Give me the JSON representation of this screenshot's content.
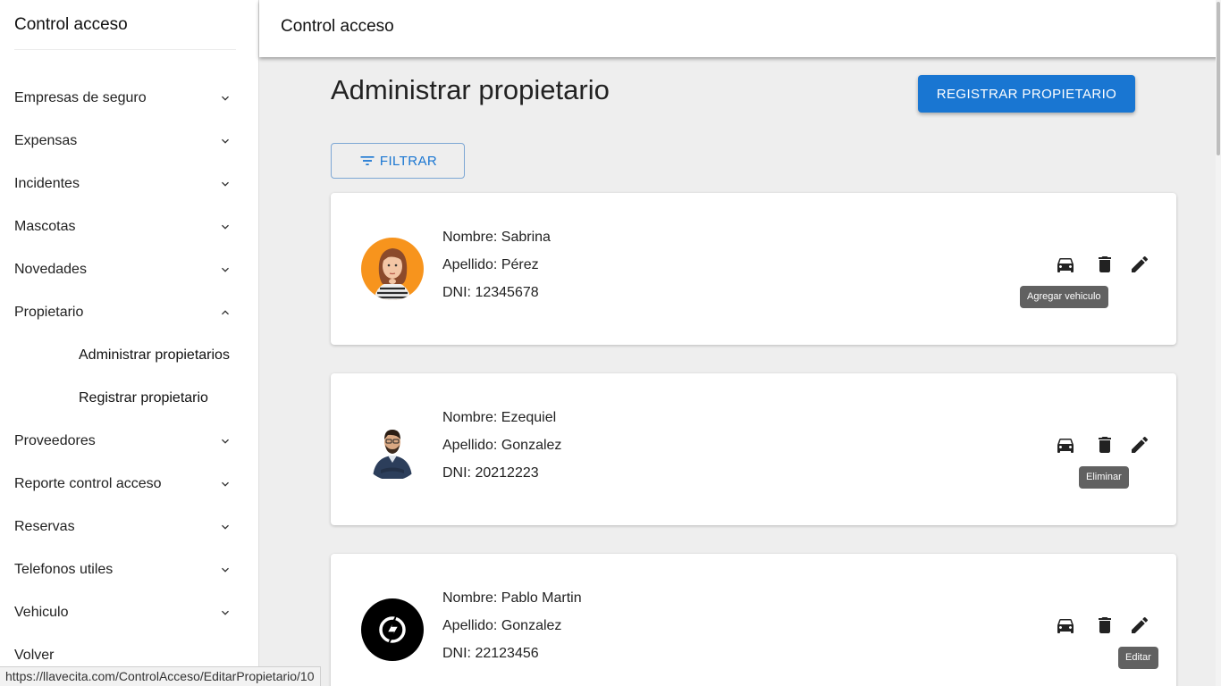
{
  "app": {
    "sidebar_title": "Control acceso",
    "topbar_title": "Control acceso"
  },
  "sidebar": {
    "items": [
      {
        "label": "Empresas de seguro",
        "chevron": "chevron-down-icon"
      },
      {
        "label": "Expensas",
        "chevron": "chevron-down-icon"
      },
      {
        "label": "Incidentes",
        "chevron": "chevron-down-icon"
      },
      {
        "label": "Mascotas",
        "chevron": "chevron-down-icon"
      },
      {
        "label": "Novedades",
        "chevron": "chevron-down-icon"
      },
      {
        "label": "Propietario",
        "chevron": "chevron-up-icon",
        "expanded": true,
        "subitems": [
          {
            "label": "Administrar propietarios"
          },
          {
            "label": "Registrar propietario"
          }
        ]
      },
      {
        "label": "Proveedores",
        "chevron": "chevron-down-icon"
      },
      {
        "label": "Reporte control acceso",
        "chevron": "chevron-down-icon"
      },
      {
        "label": "Reservas",
        "chevron": "chevron-down-icon"
      },
      {
        "label": "Telefonos utiles",
        "chevron": "chevron-down-icon"
      },
      {
        "label": "Vehiculo",
        "chevron": "chevron-down-icon"
      },
      {
        "label": "Volver"
      }
    ]
  },
  "main": {
    "page_title": "Administrar propietario",
    "register_label": "REGISTRAR PROPIETARIO",
    "filter_label": "FILTRAR",
    "owners": [
      {
        "nombre": "Nombre: Sabrina",
        "apellido": "Apellido: Pérez",
        "dni": "DNI: 12345678",
        "avatar": "woman-thinking-avatar",
        "tooltip": "Agregar vehiculo"
      },
      {
        "nombre": "Nombre: Ezequiel",
        "apellido": "Apellido: Gonzalez",
        "dni": "DNI: 20212223",
        "avatar": "man-glasses-avatar",
        "tooltip": "Eliminar"
      },
      {
        "nombre": "Nombre: Pablo Martin",
        "apellido": "Apellido: Gonzalez",
        "dni": "DNI: 22123456",
        "avatar": "black-logo-avatar",
        "tooltip": "Editar"
      }
    ]
  },
  "status_bar": {
    "url": "https://llavecita.com/ControlAcceso/EditarPropietario/10"
  },
  "colors": {
    "primary": "#1976d2",
    "background": "#eeeeee",
    "tooltip": "#616161"
  }
}
